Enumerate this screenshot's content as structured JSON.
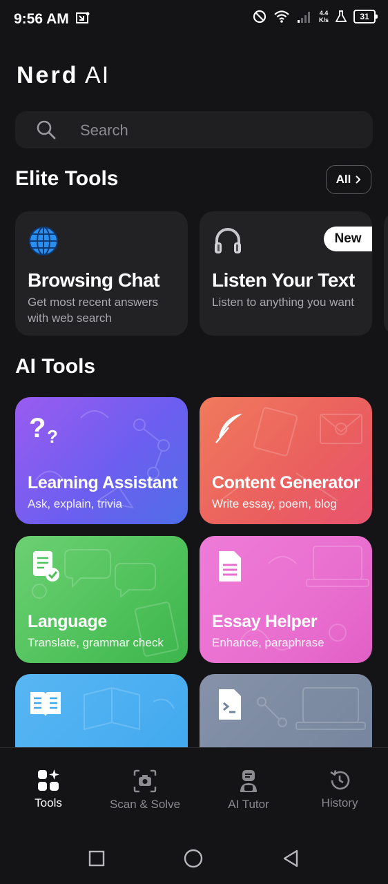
{
  "status": {
    "time": "9:56 AM",
    "net_speed_top": "4.4",
    "net_speed_bottom": "K/s",
    "battery": "31"
  },
  "app": {
    "title_bold": "Nerd",
    "title_light": "AI"
  },
  "search": {
    "placeholder": "Search"
  },
  "elite": {
    "heading": "Elite Tools",
    "all_label": "All",
    "cards": [
      {
        "title": "Browsing Chat",
        "subtitle": "Get most recent answers with web search",
        "icon": "globe-icon"
      },
      {
        "title": "Listen Your Text",
        "subtitle": "Listen to anything you want",
        "icon": "headphones-icon",
        "badge": "New"
      }
    ]
  },
  "ai_tools": {
    "heading": "AI Tools",
    "cards": [
      {
        "title": "Learning Assistant",
        "subtitle": "Ask, explain, trivia",
        "icon": "question-marks-icon",
        "color": "#6d5ef0"
      },
      {
        "title": "Content Generator",
        "subtitle": "Write essay, poem, blog",
        "icon": "feather-icon",
        "color": "#ea5f5f"
      },
      {
        "title": "Language",
        "subtitle": "Translate, grammar check",
        "icon": "document-check-icon",
        "color": "#4fc15a"
      },
      {
        "title": "Essay Helper",
        "subtitle": "Enhance, paraphrase",
        "icon": "document-icon",
        "color": "#e96fcf"
      },
      {
        "icon": "open-book-icon",
        "color": "#3ea7ee"
      },
      {
        "icon": "terminal-file-icon",
        "color": "#74839c"
      }
    ]
  },
  "nav": [
    {
      "label": "Tools",
      "icon": "tools-grid-icon",
      "active": true
    },
    {
      "label": "Scan & Solve",
      "icon": "camera-scan-icon"
    },
    {
      "label": "AI Tutor",
      "icon": "tutor-icon"
    },
    {
      "label": "History",
      "icon": "history-icon"
    }
  ]
}
